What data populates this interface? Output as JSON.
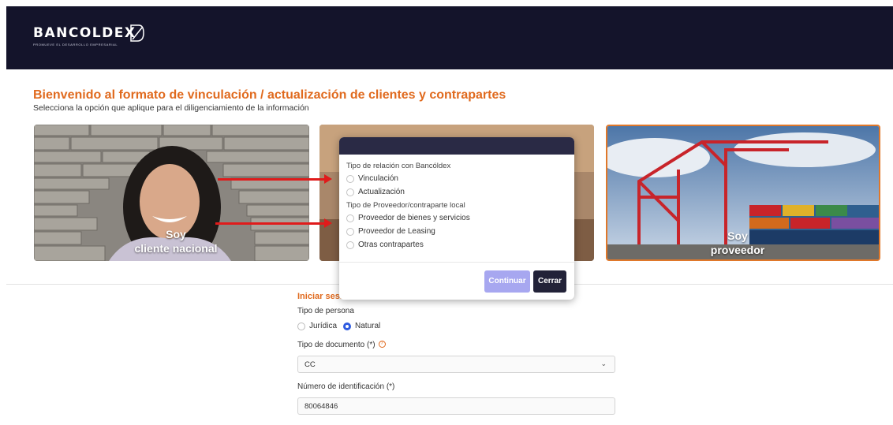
{
  "header": {
    "brand": "BANCOLDEX",
    "tagline": "PROMUEVE EL DESARROLLO EMPRESARIAL"
  },
  "main": {
    "title": "Bienvenido al formato de vinculación / actualización de clientes y contrapartes",
    "subtitle": "Selecciona la opción que aplique para el diligenciamiento de la información",
    "cards": [
      {
        "line1": "Soy",
        "line2": "cliente nacional"
      },
      {
        "line1": "",
        "line2": ""
      },
      {
        "line1": "Soy",
        "line2": "proveedor"
      }
    ]
  },
  "login": {
    "title": "Iniciar sesión",
    "person_type_label": "Tipo de persona",
    "person_types": [
      "Jurídica",
      "Natural"
    ],
    "selected_person_type": "Natural",
    "doc_type_label": "Tipo de documento (*)",
    "doc_type_value": "CC",
    "id_label": "Número de identificación (*)",
    "id_value": "80064846"
  },
  "modal": {
    "section1_label": "Tipo de relación con Bancóldex",
    "section1_options": [
      "Vinculación",
      "Actualización"
    ],
    "section2_label": "Tipo de Proveedor/contraparte local",
    "section2_options": [
      "Proveedor de bienes y servicios",
      "Proveedor de Leasing",
      "Otras contrapartes"
    ],
    "continue_label": "Continuar",
    "close_label": "Cerrar"
  },
  "colors": {
    "header_bg": "#14142b",
    "accent": "#e06a1e",
    "primary": "#2e5be0",
    "arrow": "#e01b1b"
  }
}
